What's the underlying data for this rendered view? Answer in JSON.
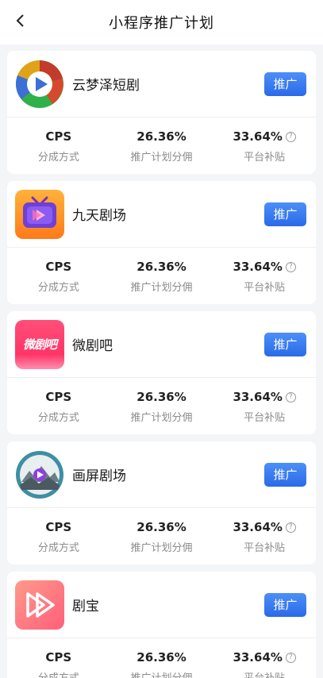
{
  "header": {
    "title": "小程序推广计划"
  },
  "labels": {
    "split_method": "分成方式",
    "plan_commission": "推广计划分佣",
    "platform_subsidy": "平台补贴",
    "promote": "推广"
  },
  "programs": [
    {
      "name": "云梦泽短剧",
      "logo_icon": "play-triangle-circle-icon",
      "split": "CPS",
      "commission": "26.36%",
      "subsidy": "33.64%"
    },
    {
      "name": "九天剧场",
      "logo_icon": "tv-play-icon",
      "split": "CPS",
      "commission": "26.36%",
      "subsidy": "33.64%"
    },
    {
      "name": "微剧吧",
      "logo_icon": "weijuba-logo",
      "logo_text": "微剧吧",
      "split": "CPS",
      "commission": "26.36%",
      "subsidy": "33.64%"
    },
    {
      "name": "画屏剧场",
      "logo_icon": "landscape-play-icon",
      "split": "CPS",
      "commission": "26.36%",
      "subsidy": "33.64%"
    },
    {
      "name": "剧宝",
      "logo_icon": "double-play-icon",
      "split": "CPS",
      "commission": "26.36%",
      "subsidy": "33.64%"
    }
  ]
}
